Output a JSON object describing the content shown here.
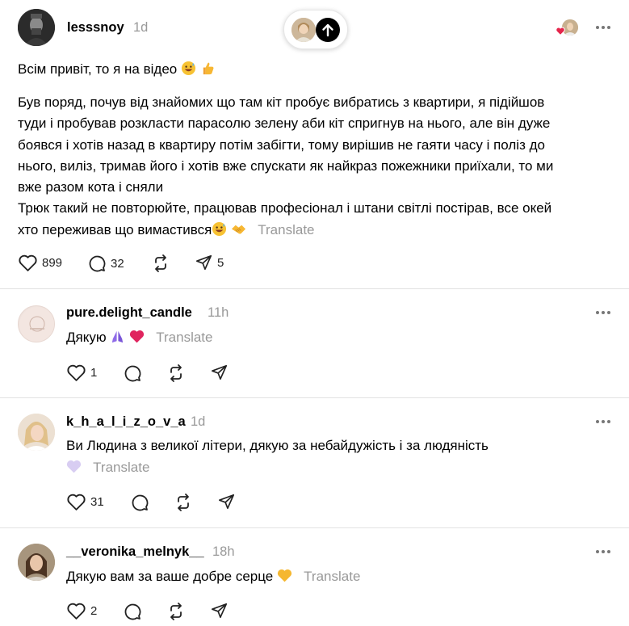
{
  "post": {
    "username": "lesssnoy",
    "time": "1d",
    "line1": "Всім привіт, то я на відео",
    "body_lines": [
      "Був поряд, почув від знайомих що там кіт пробує вибратись з квартири, я підійшов",
      "туди і пробував розкласти парасолю зелену аби кіт спригнув на нього, але він дуже",
      "боявся і хотів назад в квартиру потім забігти, тому вирішив не гаяти часу і поліз до",
      "нього, виліз, тримав його і хотів вже спускати як найкраз пожежники приїхали, то ми",
      "вже разом кота і сняли",
      "Трюк такий не повторюйте, працював професіонал і штани світлі постірав, все окей"
    ],
    "last_line": "хто переживав що вимастився",
    "translate": "Translate",
    "likes": "899",
    "comments": "32",
    "shares": "5"
  },
  "replies": [
    {
      "username": "pure.delight_candle",
      "time": "11h",
      "text": "Дякую",
      "translate": "Translate",
      "likes": "1"
    },
    {
      "username": "k_h_a_l_i_z_o_v_a",
      "time": "1d",
      "text": "Ви Людина з великої літери, дякую за небайдужість і за людяність",
      "translate": "Translate",
      "likes": "31"
    },
    {
      "username": "__veronika_melnyk__",
      "time": "18h",
      "text": "Дякую вам за ваше добре серце",
      "translate": "Translate",
      "likes": "2"
    }
  ],
  "icons": {
    "like": "heart-icon",
    "comment": "comment-icon",
    "repost": "repost-icon",
    "share": "share-icon",
    "more": "more-icon",
    "scroll_up": "arrow-up-icon"
  },
  "colors": {
    "accent_heart": "#e5254b",
    "muted_text": "#999999",
    "divider": "#e2e2e2"
  }
}
